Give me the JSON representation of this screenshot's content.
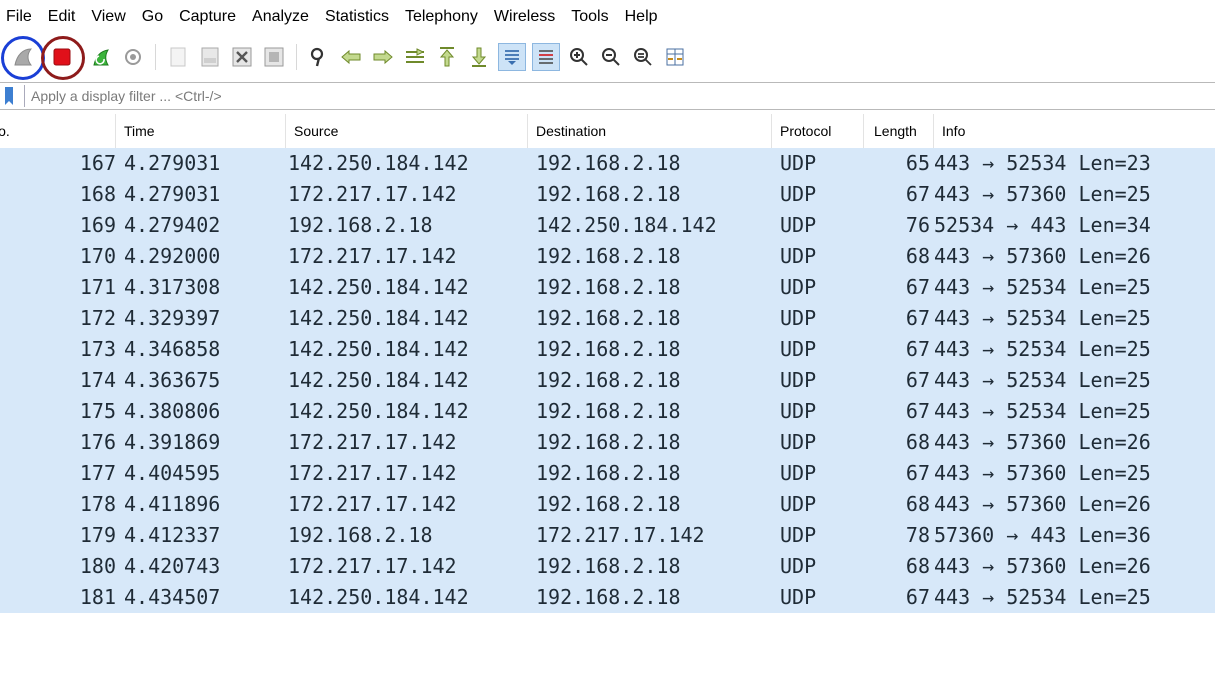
{
  "menu": [
    "File",
    "Edit",
    "View",
    "Go",
    "Capture",
    "Analyze",
    "Statistics",
    "Telephony",
    "Wireless",
    "Tools",
    "Help"
  ],
  "toolbar": {
    "buttons": [
      "start-capture",
      "stop-capture",
      "restart-capture",
      "capture-options",
      "open-file",
      "save-file",
      "close-file",
      "reload-file",
      "find-packet",
      "go-back",
      "go-forward",
      "go-to-packet",
      "go-first",
      "go-last",
      "auto-scroll",
      "colorize",
      "zoom-in",
      "zoom-out",
      "zoom-normal",
      "resize-columns"
    ],
    "highlight_colors": {
      "start": "#1a3fd6",
      "stop": "#8e1b1b"
    }
  },
  "filter": {
    "placeholder": "Apply a display filter ... <Ctrl-/>",
    "value": ""
  },
  "columns": {
    "no": "No.",
    "time": "Time",
    "source": "Source",
    "destination": "Destination",
    "protocol": "Protocol",
    "length": "Length",
    "info": "Info"
  },
  "row_color": "#d7e8f9",
  "packets": [
    {
      "no": "167",
      "time": "4.279031",
      "source": "142.250.184.142",
      "destination": "192.168.2.18",
      "protocol": "UDP",
      "length": "65",
      "info": "443 → 52534 Len=23"
    },
    {
      "no": "168",
      "time": "4.279031",
      "source": "172.217.17.142",
      "destination": "192.168.2.18",
      "protocol": "UDP",
      "length": "67",
      "info": "443 → 57360 Len=25"
    },
    {
      "no": "169",
      "time": "4.279402",
      "source": "192.168.2.18",
      "destination": "142.250.184.142",
      "protocol": "UDP",
      "length": "76",
      "info": "52534 → 443 Len=34"
    },
    {
      "no": "170",
      "time": "4.292000",
      "source": "172.217.17.142",
      "destination": "192.168.2.18",
      "protocol": "UDP",
      "length": "68",
      "info": "443 → 57360 Len=26"
    },
    {
      "no": "171",
      "time": "4.317308",
      "source": "142.250.184.142",
      "destination": "192.168.2.18",
      "protocol": "UDP",
      "length": "67",
      "info": "443 → 52534 Len=25"
    },
    {
      "no": "172",
      "time": "4.329397",
      "source": "142.250.184.142",
      "destination": "192.168.2.18",
      "protocol": "UDP",
      "length": "67",
      "info": "443 → 52534 Len=25"
    },
    {
      "no": "173",
      "time": "4.346858",
      "source": "142.250.184.142",
      "destination": "192.168.2.18",
      "protocol": "UDP",
      "length": "67",
      "info": "443 → 52534 Len=25"
    },
    {
      "no": "174",
      "time": "4.363675",
      "source": "142.250.184.142",
      "destination": "192.168.2.18",
      "protocol": "UDP",
      "length": "67",
      "info": "443 → 52534 Len=25"
    },
    {
      "no": "175",
      "time": "4.380806",
      "source": "142.250.184.142",
      "destination": "192.168.2.18",
      "protocol": "UDP",
      "length": "67",
      "info": "443 → 52534 Len=25"
    },
    {
      "no": "176",
      "time": "4.391869",
      "source": "172.217.17.142",
      "destination": "192.168.2.18",
      "protocol": "UDP",
      "length": "68",
      "info": "443 → 57360 Len=26"
    },
    {
      "no": "177",
      "time": "4.404595",
      "source": "172.217.17.142",
      "destination": "192.168.2.18",
      "protocol": "UDP",
      "length": "67",
      "info": "443 → 57360 Len=25"
    },
    {
      "no": "178",
      "time": "4.411896",
      "source": "172.217.17.142",
      "destination": "192.168.2.18",
      "protocol": "UDP",
      "length": "68",
      "info": "443 → 57360 Len=26"
    },
    {
      "no": "179",
      "time": "4.412337",
      "source": "192.168.2.18",
      "destination": "172.217.17.142",
      "protocol": "UDP",
      "length": "78",
      "info": "57360 → 443 Len=36"
    },
    {
      "no": "180",
      "time": "4.420743",
      "source": "172.217.17.142",
      "destination": "192.168.2.18",
      "protocol": "UDP",
      "length": "68",
      "info": "443 → 57360 Len=26"
    },
    {
      "no": "181",
      "time": "4.434507",
      "source": "142.250.184.142",
      "destination": "192.168.2.18",
      "protocol": "UDP",
      "length": "67",
      "info": "443 → 52534 Len=25"
    }
  ]
}
